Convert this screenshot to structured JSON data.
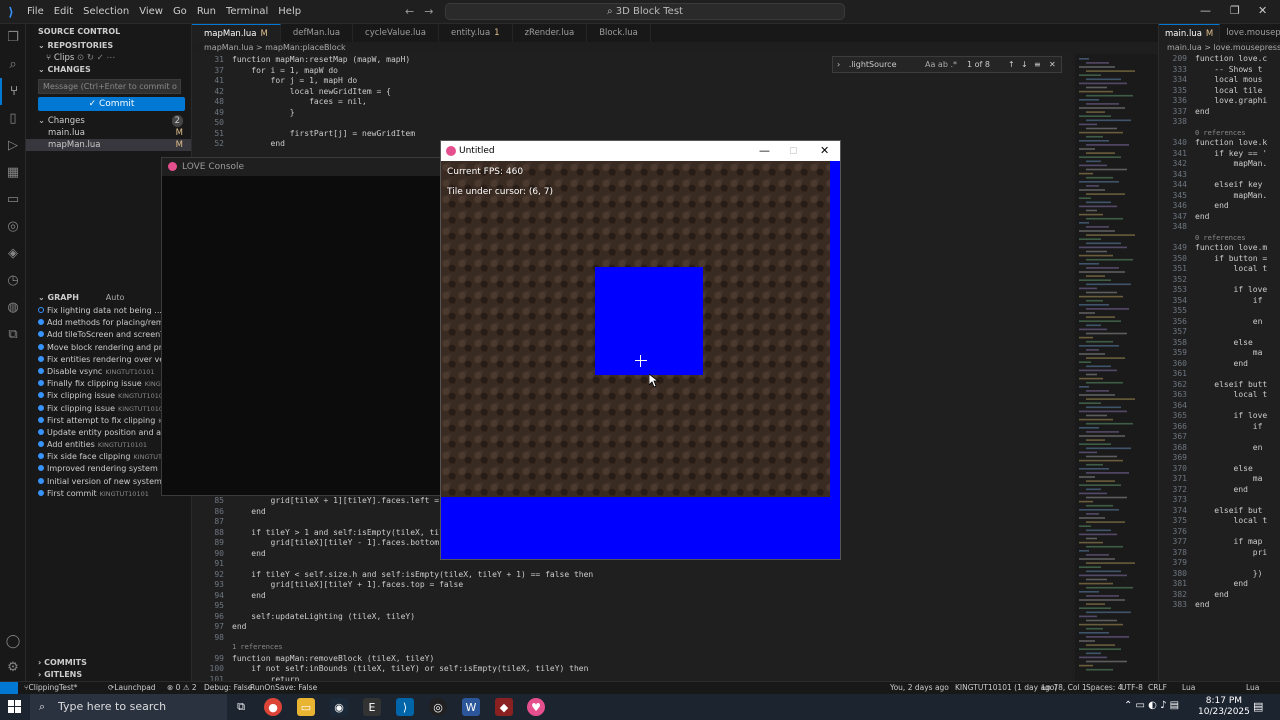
{
  "titlebar": {
    "menu": [
      "File",
      "Edit",
      "Selection",
      "View",
      "Go",
      "Run",
      "Terminal",
      "Help"
    ],
    "search_text": "3D Block Test"
  },
  "sidebar": {
    "header": "SOURCE CONTROL",
    "repositories": "REPOSITORIES",
    "repo_name": "Clips",
    "changes_header": "CHANGES",
    "commit_placeholder": "Message (Ctrl+Enter to commit o",
    "commit_label": "✓ Commit",
    "changes_group": "Changes",
    "changes_count": "2",
    "files": [
      {
        "name": "main.lua",
        "status": "M"
      },
      {
        "name": "mapMan.lua",
        "status": "M"
      }
    ],
    "graph_header": "GRAPH",
    "graph_auto": "Auto",
    "graph": [
      {
        "msg": "Fix lighting data not being ...",
        "author": "",
        "tag": "Clipp"
      },
      {
        "msg": "Add methods for placing/removing bl",
        "author": ""
      },
      {
        "msg": "Add tileToScreen and screenToTile met",
        "author": ""
      },
      {
        "msg": "Move block rendering and processing",
        "author": ""
      },
      {
        "msg": "Fix entities rendering over vertical face",
        "author": ""
      },
      {
        "msg": "Disable vsync",
        "author": "KINGTUT10101"
      },
      {
        "msg": "Finally fix clipping issue",
        "author": "KINGTUT10101"
      },
      {
        "msg": "Fix clipping issue",
        "author": "KINGTUT10101"
      },
      {
        "msg": "Fix clipping issue",
        "author": "KINGTUT10101"
      },
      {
        "msg": "First attempt to fix clipping",
        "author": "KINGTUT10101"
      },
      {
        "msg": "Update entity position and adjust test",
        "author": ""
      },
      {
        "msg": "Add entities",
        "author": "KINGTUT10101"
      },
      {
        "msg": "Fix side face clipping",
        "author": "KINGTUT10101"
      },
      {
        "msg": "Improved rendering system",
        "author": "KINGTUT101"
      },
      {
        "msg": "Initial version of new system",
        "author": "KINGTUT1"
      },
      {
        "msg": "First commit",
        "author": "KINGTUT10101"
      }
    ],
    "commits": "COMMITS",
    "gitlens": "GITLENS"
  },
  "tabs": [
    {
      "label": "mapMan.lua",
      "mod": "M",
      "active": true
    },
    {
      "label": "defMan.lua",
      "mod": ""
    },
    {
      "label": "cycleValue.lua",
      "mod": ""
    },
    {
      "label": "entity.lua",
      "mod": "1"
    },
    {
      "label": "zRender.lua",
      "mod": ""
    },
    {
      "label": "Block.lua",
      "mod": ""
    }
  ],
  "breadcrumb": "mapMan.lua > mapMan:placeBlock",
  "code_top": [
    {
      "n": "31",
      "t": "function mapMan:resetMap (mapW, mapH)"
    },
    {
      "n": "37",
      "t": "    for i = 1, mapW do"
    },
    {
      "n": "41",
      "t": "        for j = 1, mapH do"
    },
    {
      "n": "42",
      "t": "            local newGridItem = {"
    },
    {
      "n": "48",
      "t": "                faces = nil,"
    },
    {
      "n": "49",
      "t": "            }"
    },
    {
      "n": "50",
      "t": ""
    },
    {
      "n": "51",
      "t": "            firstPart[j] = newGridItem"
    },
    {
      "n": "52",
      "t": "        end"
    }
  ],
  "code_bottom": [
    {
      "n": "85",
      "t": "        grid[tileX + 1][tileY].faces.left = false"
    },
    {
      "n": "86",
      "t": "    end"
    },
    {
      "n": "87",
      "t": ""
    },
    {
      "n": "88",
      "t": "    if tileY > 1 and self:isEmpty(tileX, tileY -"
    },
    {
      "n": "89",
      "t": "        grid[tileX][tileY - 1].faces.bottom = fal"
    },
    {
      "n": "90",
      "t": "    end"
    },
    {
      "n": "91",
      "t": ""
    },
    {
      "n": "92",
      "t": "    if tileY < self.size.h and self:isEmpty(tileX, tileY + 1) == false then"
    },
    {
      "n": "93",
      "t": "        grid[tileX][tileY + 1].faces.top = false"
    },
    {
      "n": "94",
      "t": "    end"
    },
    {
      "n": "95",
      "t": ""
    },
    {
      "n": "96",
      "t": "    self:updateLighting (tileX, tileY)"
    },
    {
      "n": "97",
      "t": "end"
    },
    {
      "n": "98",
      "t": ""
    },
    {
      "n": "",
      "t": "1 references"
    },
    {
      "n": "99",
      "t": "function mapMan:removeBlock (tileX, tileY)"
    },
    {
      "n": "100",
      "t": "    if not self:inBounds (tileX, tileY) or self:isEmpty(tileX, tileY) then"
    },
    {
      "n": "101",
      "t": "        return"
    }
  ],
  "find": {
    "query": ".lightSource",
    "result": "1 of 8"
  },
  "right_tabs": [
    {
      "label": "main.lua",
      "mod": "M"
    },
    {
      "label": "love.mousepress",
      "mod": ""
    }
  ],
  "right_breadcrumb": "main.lua > love.mousepress",
  "right_code": [
    {
      "n": "209",
      "t": "function love.c"
    },
    {
      "n": "333",
      "t": "    -- Shows t"
    },
    {
      "n": "334",
      "t": "    local mous"
    },
    {
      "n": "335",
      "t": "    local tile"
    },
    {
      "n": "336",
      "t": "    love.graphi"
    },
    {
      "n": "337",
      "t": "end"
    },
    {
      "n": "338",
      "t": ""
    },
    {
      "n": "",
      "t": "0 references"
    },
    {
      "n": "340",
      "t": "function love.k"
    },
    {
      "n": "341",
      "t": "    if key == '"
    },
    {
      "n": "342",
      "t": "        mapMan."
    },
    {
      "n": "343",
      "t": ""
    },
    {
      "n": "344",
      "t": "    elseif key"
    },
    {
      "n": "345",
      "t": "        mapMan."
    },
    {
      "n": "346",
      "t": "    end"
    },
    {
      "n": "347",
      "t": "end"
    },
    {
      "n": "348",
      "t": ""
    },
    {
      "n": "",
      "t": "0 references"
    },
    {
      "n": "349",
      "t": "function love.m"
    },
    {
      "n": "350",
      "t": "    if button ="
    },
    {
      "n": "351",
      "t": "        local t"
    },
    {
      "n": "352",
      "t": ""
    },
    {
      "n": "353",
      "t": "        if love"
    },
    {
      "n": "354",
      "t": "            if"
    },
    {
      "n": "355",
      "t": ""
    },
    {
      "n": "356",
      "t": "            en"
    },
    {
      "n": "357",
      "t": ""
    },
    {
      "n": "358",
      "t": "        else"
    },
    {
      "n": "359",
      "t": "            ma"
    },
    {
      "n": "360",
      "t": "        end"
    },
    {
      "n": "361",
      "t": ""
    },
    {
      "n": "362",
      "t": "    elseif butt"
    },
    {
      "n": "363",
      "t": "        local t"
    },
    {
      "n": "364",
      "t": ""
    },
    {
      "n": "365",
      "t": "        if love"
    },
    {
      "n": "366",
      "t": "            if"
    },
    {
      "n": "367",
      "t": ""
    },
    {
      "n": "368",
      "t": "            en"
    },
    {
      "n": "369",
      "t": ""
    },
    {
      "n": "370",
      "t": "        else"
    },
    {
      "n": "371",
      "t": "            ma"
    },
    {
      "n": "372",
      "t": "        end"
    },
    {
      "n": "373",
      "t": ""
    },
    {
      "n": "374",
      "t": "    elseif but"
    },
    {
      "n": "375",
      "t": "        local t"
    },
    {
      "n": "376",
      "t": ""
    },
    {
      "n": "377",
      "t": "        if map"
    },
    {
      "n": "378",
      "t": "            pri"
    },
    {
      "n": "379",
      "t": ""
    },
    {
      "n": "380",
      "t": "            })"
    },
    {
      "n": "381",
      "t": "        end"
    },
    {
      "n": "382",
      "t": "    end"
    },
    {
      "n": "383",
      "t": "end"
    }
  ],
  "love_console": {
    "title": "LOVE Console"
  },
  "game": {
    "title": "Untitled",
    "fps": "Current FPS: 460",
    "tile": "Tile under cursor: (6, 7)"
  },
  "status": {
    "branch": "ClippingTest*",
    "launchpad": "Launchpad",
    "problems": "⊗ 0 ⚠ 2",
    "debug": "Debug: False",
    "runonsave": "RunOnSave: False",
    "blame": "You, 2 days ago",
    "author": "KINGTUT10101 (1 day ago)",
    "position": "Ln 78, Col 1",
    "spaces": "Spaces: 4",
    "encoding": "UTF-8",
    "eol": "CRLF",
    "lang": "Lua"
  },
  "taskbar": {
    "search": "Type here to search",
    "time": "8:17 PM",
    "date": "10/23/2025"
  }
}
